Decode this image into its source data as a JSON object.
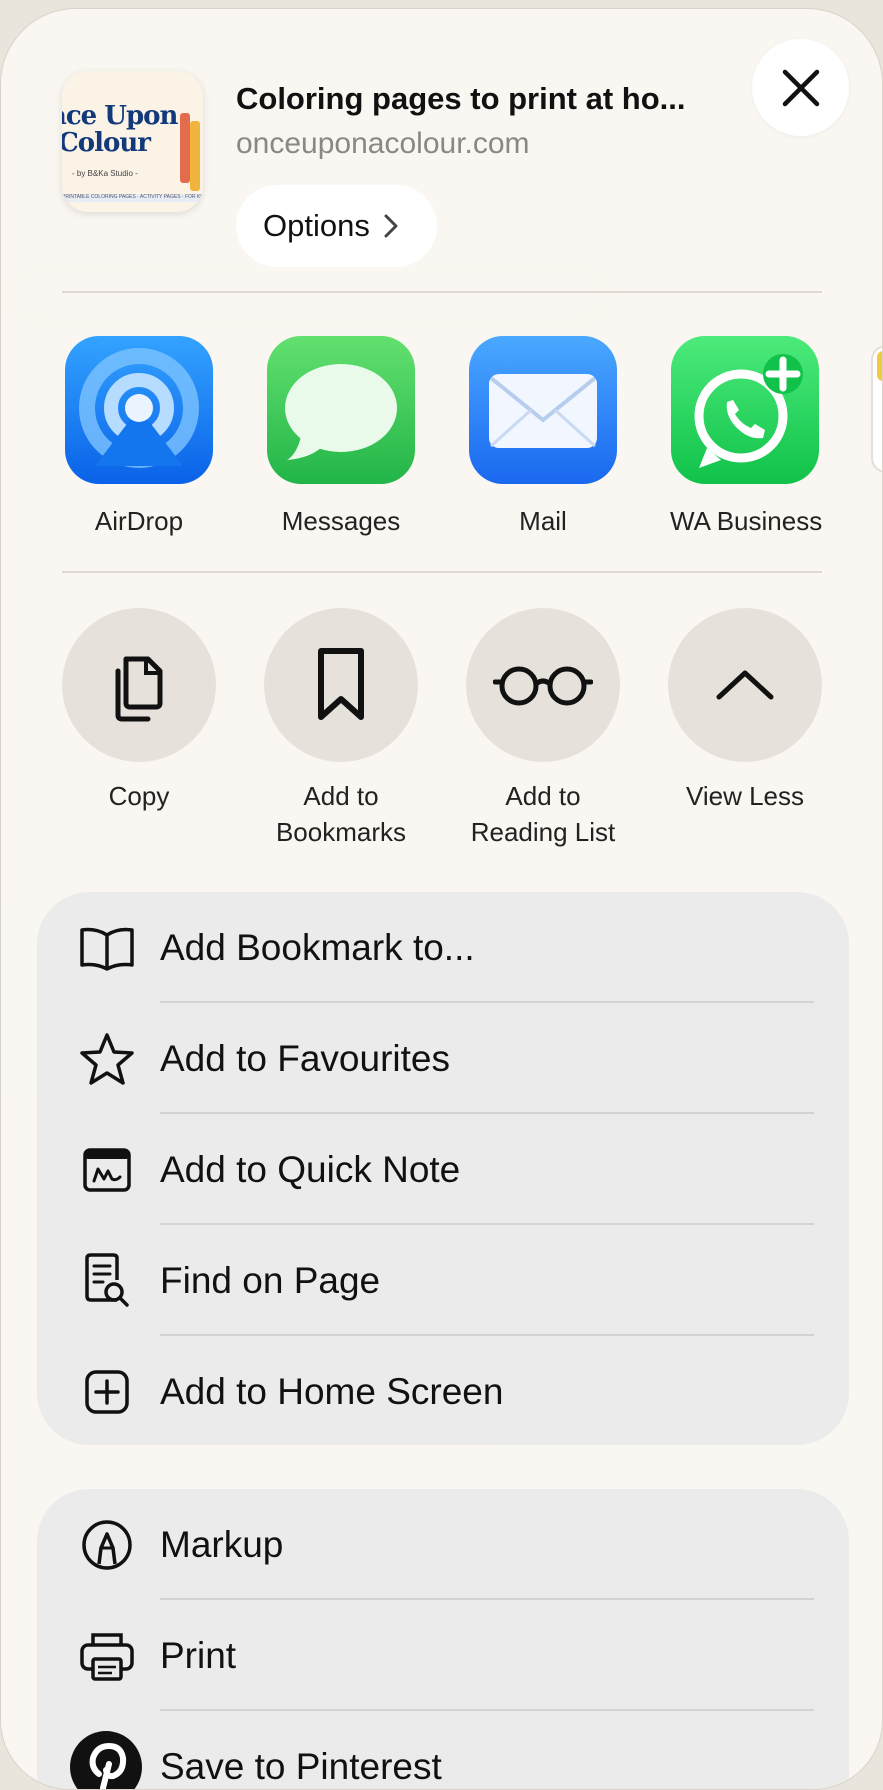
{
  "header": {
    "thumbnail": {
      "title_line1": "ace Upon",
      "title_line2": "Colour",
      "byline": "- by B&Ka Studio -",
      "strip": "PRINTABLE COLORING PAGES · ACTIVITY PAGES · FOR KIDS"
    },
    "title": "Coloring pages to print at ho...",
    "url": "onceuponacolour.com",
    "options_label": "Options",
    "close_icon": "close-icon"
  },
  "apps": [
    {
      "label": "AirDrop",
      "icon": "airdrop-icon",
      "color": "#1a7cf5"
    },
    {
      "label": "Messages",
      "icon": "messages-icon",
      "color": "#35c759"
    },
    {
      "label": "Mail",
      "icon": "mail-icon",
      "color": "#2a86f7"
    },
    {
      "label": "WA Business",
      "icon": "whatsapp-business-icon",
      "color": "#1ed75d"
    }
  ],
  "actions": [
    {
      "label": "Copy",
      "icon": "copy-icon"
    },
    {
      "label": "Add to\nBookmarks",
      "icon": "bookmark-icon"
    },
    {
      "label": "Add to\nReading List",
      "icon": "glasses-icon"
    },
    {
      "label": "View Less",
      "icon": "chevron-up-icon"
    }
  ],
  "menu_group_1": [
    {
      "label": "Add Bookmark to...",
      "icon": "book-icon"
    },
    {
      "label": "Add to Favourites",
      "icon": "star-icon"
    },
    {
      "label": "Add to Quick Note",
      "icon": "quick-note-icon"
    },
    {
      "label": "Find on Page",
      "icon": "find-on-page-icon"
    },
    {
      "label": "Add to Home Screen",
      "icon": "add-square-icon"
    }
  ],
  "menu_group_2": [
    {
      "label": "Markup",
      "icon": "markup-icon"
    },
    {
      "label": "Print",
      "icon": "printer-icon"
    },
    {
      "label": "Save to Pinterest",
      "icon": "pinterest-icon"
    }
  ]
}
